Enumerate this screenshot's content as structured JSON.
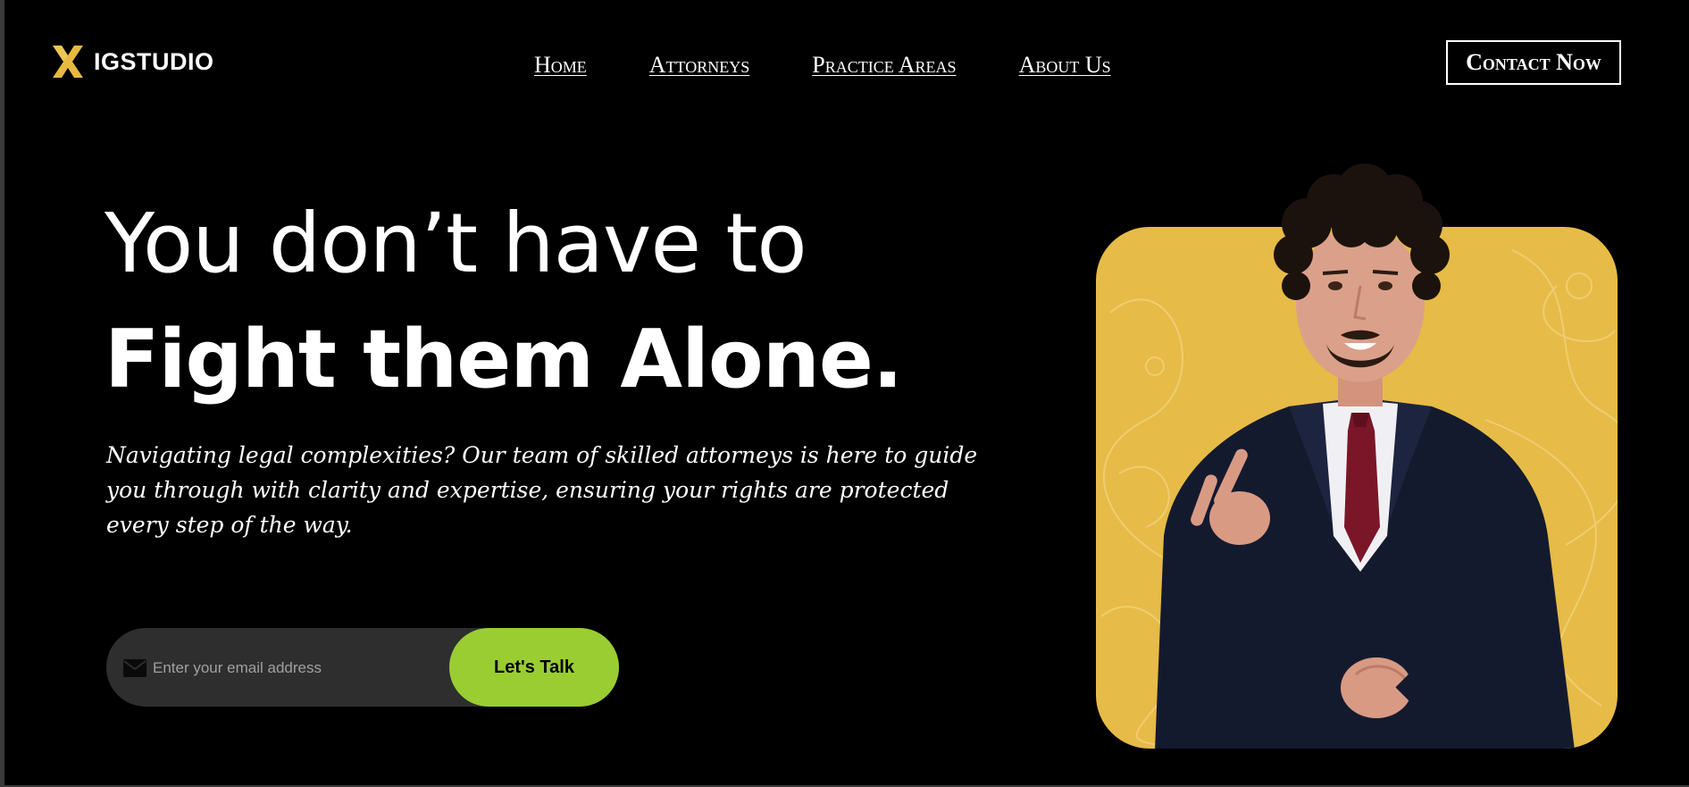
{
  "brand": {
    "name": "IGSTUDIO",
    "logo_icon": "x-logo-icon",
    "accent_color": "#e7b93e"
  },
  "nav": {
    "items": [
      {
        "label": "Home"
      },
      {
        "label": "Attorneys"
      },
      {
        "label": "Practice Areas"
      },
      {
        "label": "About Us"
      }
    ],
    "contact_label": "Contact Now"
  },
  "hero": {
    "headline_line1": "You don’t have to",
    "headline_line2": "Fight them Alone.",
    "description": "Navigating legal complexities? Our team of skilled attorneys is here to guide you through with clarity and expertise, ensuring your rights are protected every step of the way.",
    "email_placeholder": "Enter your email address",
    "email_icon": "mail-icon",
    "cta_label": "Let's Talk",
    "cta_color": "#9acd32",
    "image_background_color": "#e6bb47"
  }
}
